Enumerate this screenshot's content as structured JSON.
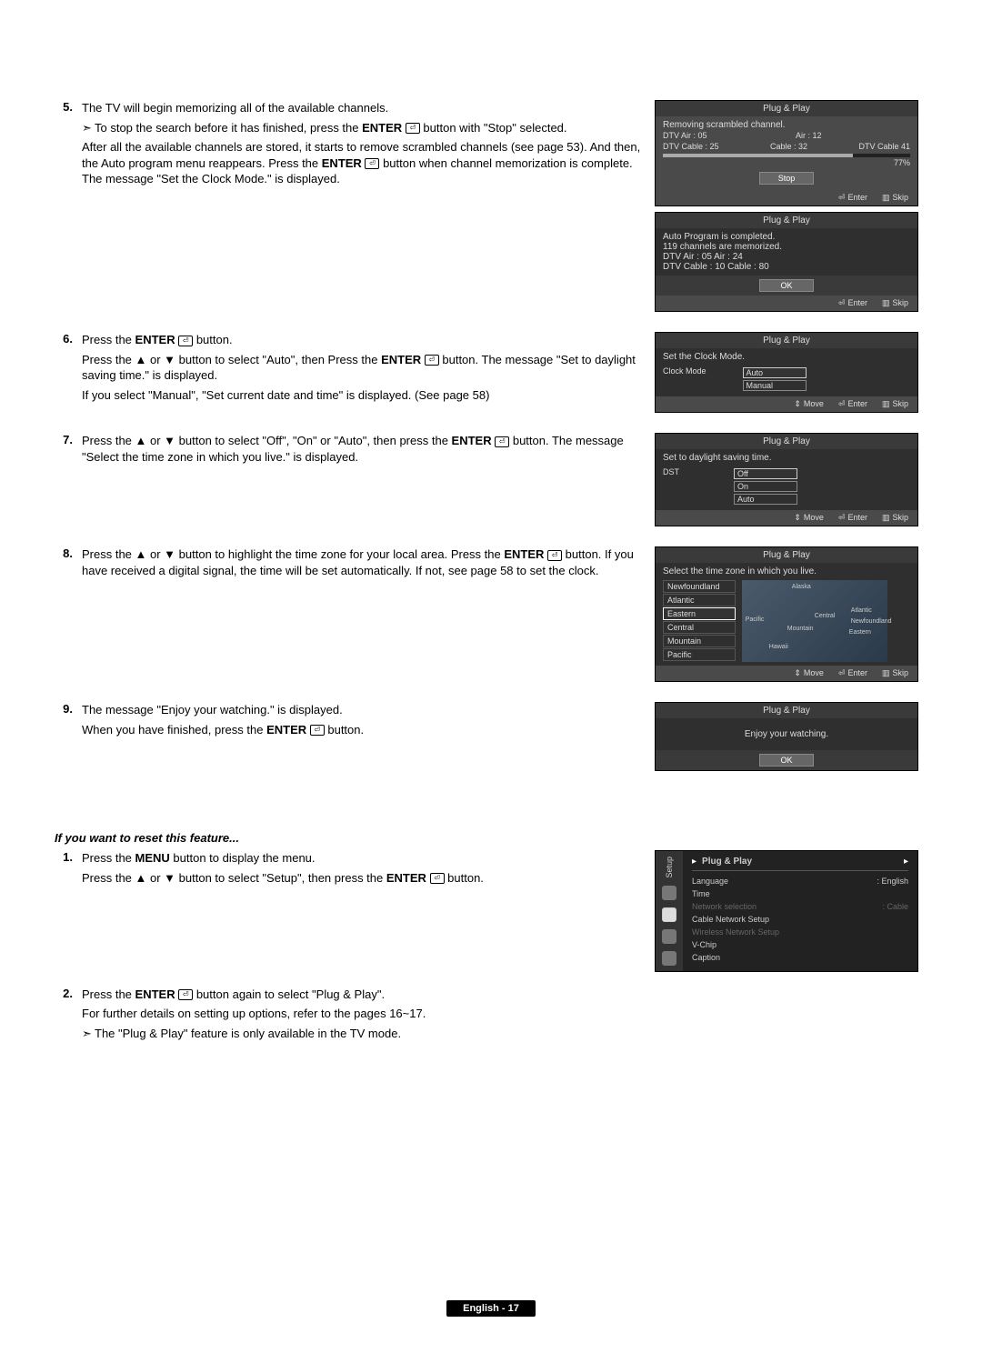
{
  "steps": {
    "s5": {
      "num": "5.",
      "p1": "The TV will begin memorizing all of the available channels.",
      "sub": "To stop the search before it has finished, press the ENTER ⏎ button with \"Stop\" selected.",
      "p2": "After all the available channels are stored, it starts to remove scrambled channels (see page 53). And then, the Auto program menu reappears. Press the ENTER ⏎ button when channel memorization is complete. The message \"Set the Clock Mode.\" is displayed."
    },
    "s6": {
      "num": "6.",
      "p1": "Press the ENTER ⏎ button.",
      "p2": "Press the ▲ or ▼ button to select \"Auto\", then Press the ENTER ⏎ button. The message \"Set to daylight saving time.\" is displayed.",
      "p3": "If you select \"Manual\", \"Set current date and time\" is displayed. (See page 58)"
    },
    "s7": {
      "num": "7.",
      "p1": "Press the ▲ or ▼ button to select \"Off\", \"On\" or \"Auto\", then press the ENTER ⏎ button. The message \"Select the time zone in which you live.\" is displayed."
    },
    "s8": {
      "num": "8.",
      "p1": "Press the ▲ or ▼ button to highlight the time zone for your local area. Press the ENTER ⏎ button. If you have received a digital signal, the time will be set automatically. If not, see page 58 to set the clock."
    },
    "s9": {
      "num": "9.",
      "p1": "The message \"Enjoy your watching.\" is displayed.",
      "p2": "When you have finished, press the ENTER ⏎ button."
    }
  },
  "reset": {
    "heading": "If you want to reset this feature...",
    "r1": {
      "num": "1.",
      "p1": "Press the MENU button to display the menu.",
      "p2": "Press the ▲ or ▼ button to select \"Setup\", then press the ENTER ⏎ button."
    },
    "r2": {
      "num": "2.",
      "p1": "Press the ENTER ⏎ button again to select \"Plug & Play\".",
      "p2": "For further details on setting up options, refer to the pages 16~17.",
      "sub": "The \"Plug & Play\" feature is only available in the TV mode."
    }
  },
  "osd": {
    "title": "Plug & Play",
    "s1": {
      "msg": "Removing scrambled channel.",
      "a": "DTV Air : 05",
      "b": "Air : 12",
      "c": "DTV Cable : 25",
      "d": "Cable : 32",
      "e": "DTV Cable 41",
      "pct": "77%",
      "btn": "Stop"
    },
    "s2": {
      "l1": "Auto Program is completed.",
      "l2": "119 channels are memorized.",
      "l3": "DTV Air : 05    Air : 24",
      "l4": "DTV Cable : 10    Cable : 80",
      "btn": "OK"
    },
    "s3": {
      "msg": "Set the Clock Mode.",
      "label": "Clock Mode",
      "o1": "Auto",
      "o2": "Manual"
    },
    "s4": {
      "msg": "Set to daylight saving time.",
      "label": "DST",
      "o1": "Off",
      "o2": "On",
      "o3": "Auto"
    },
    "s5": {
      "msg": "Select the time zone in which you live.",
      "tz": [
        "Newfoundland",
        "Atlantic",
        "Eastern",
        "Central",
        "Mountain",
        "Pacific"
      ],
      "map": [
        "Alaska",
        "Pacific",
        "Mountain",
        "Central",
        "Eastern",
        "Atlantic",
        "Newfoundland",
        "Hawaii"
      ]
    },
    "s6": {
      "msg": "Enjoy your watching.",
      "btn": "OK"
    },
    "foot": {
      "enter": "Enter",
      "skip": "Skip",
      "move": "Move"
    }
  },
  "setup_menu": {
    "side_label": "Setup",
    "head": "Plug & Play",
    "items": [
      {
        "label": "Language",
        "val": ": English",
        "dim": false
      },
      {
        "label": "Time",
        "val": "",
        "dim": false
      },
      {
        "label": "Network selection",
        "val": ": Cable",
        "dim": true
      },
      {
        "label": "Cable Network Setup",
        "val": "",
        "dim": false
      },
      {
        "label": "Wireless Network Setup",
        "val": "",
        "dim": true
      },
      {
        "label": "V-Chip",
        "val": "",
        "dim": false
      },
      {
        "label": "Caption",
        "val": "",
        "dim": false
      }
    ]
  },
  "footer": "English - 17"
}
